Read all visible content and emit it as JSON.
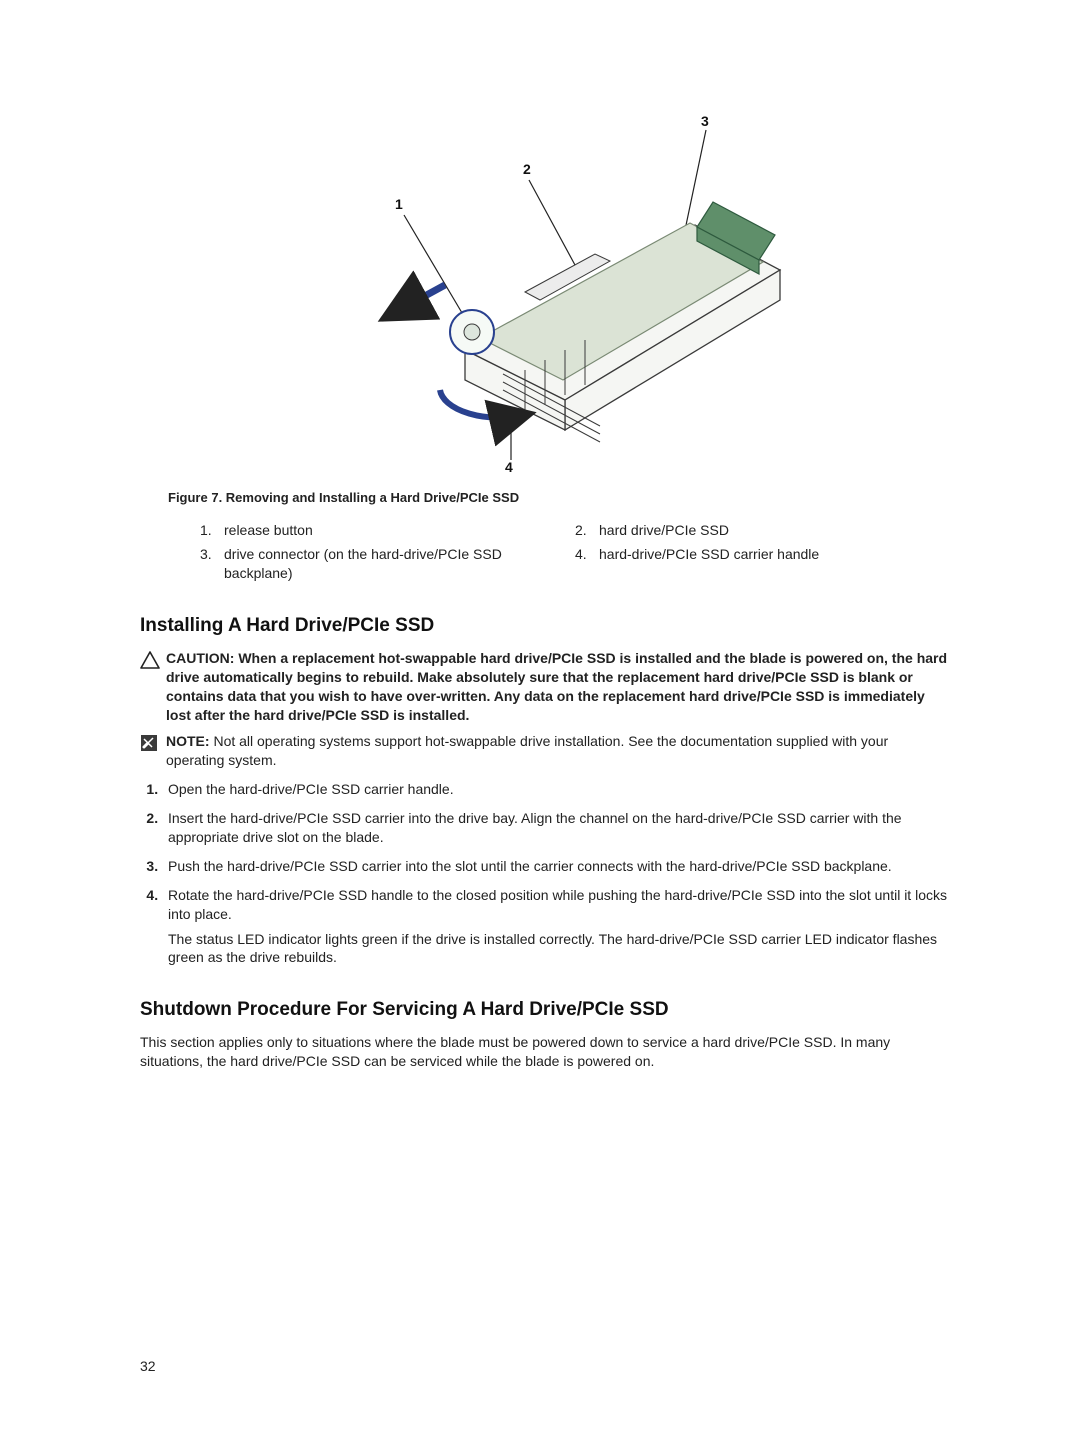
{
  "figure": {
    "callouts": {
      "c1": "1",
      "c2": "2",
      "c3": "3",
      "c4": "4"
    },
    "caption": "Figure 7. Removing and Installing a Hard Drive/PCIe SSD",
    "legend": [
      {
        "num": "1.",
        "text": "release button"
      },
      {
        "num": "2.",
        "text": "hard drive/PCIe SSD"
      },
      {
        "num": "3.",
        "text": "drive connector (on the hard-drive/PCIe SSD backplane)"
      },
      {
        "num": "4.",
        "text": "hard-drive/PCIe SSD carrier handle"
      }
    ]
  },
  "section1": {
    "heading": "Installing A Hard Drive/PCIe SSD",
    "caution_label": "CAUTION: ",
    "caution_text": "When a replacement hot-swappable hard drive/PCIe SSD is installed and the blade is powered on, the hard drive automatically begins to rebuild. Make absolutely sure that the replacement hard drive/PCIe SSD is blank or contains data that you wish to have over-written. Any data on the replacement hard drive/PCIe SSD is immediately lost after the hard drive/PCIe SSD is installed.",
    "note_label": "NOTE: ",
    "note_text": "Not all operating systems support hot-swappable drive installation. See the documentation supplied with your operating system.",
    "steps": {
      "s1": "Open the hard-drive/PCIe SSD carrier handle.",
      "s2": "Insert the hard-drive/PCIe SSD carrier into the drive bay. Align the channel on the hard-drive/PCIe SSD carrier with the appropriate drive slot on the blade.",
      "s3": "Push the hard-drive/PCIe SSD carrier into the slot until the carrier connects with the hard-drive/PCIe SSD backplane.",
      "s4a": "Rotate the hard-drive/PCIe SSD handle to the closed position while pushing the hard-drive/PCIe SSD into the slot until it locks into place.",
      "s4b": "The status LED indicator lights green if the drive is installed correctly. The hard-drive/PCIe SSD carrier LED indicator flashes green as the drive rebuilds."
    }
  },
  "section2": {
    "heading": "Shutdown Procedure For Servicing A Hard Drive/PCIe SSD",
    "para": "This section applies only to situations where the blade must be powered down to service a hard drive/PCIe SSD. In many situations, the hard drive/PCIe SSD can be serviced while the blade is powered on."
  },
  "page_number": "32"
}
